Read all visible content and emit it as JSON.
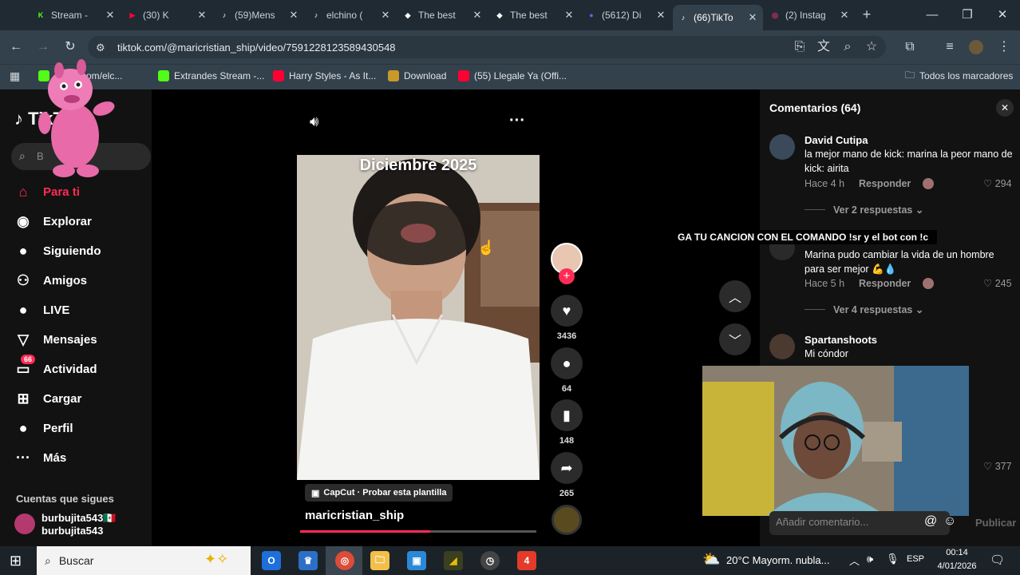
{
  "browser": {
    "tabs": [
      {
        "title": "Stream - ",
        "fav_letter": "K",
        "fav_color": "#53fc18"
      },
      {
        "title": "(30) K",
        "fav_letter": "▶",
        "fav_color": "#ff0033"
      },
      {
        "title": "(59)Mens",
        "fav_letter": "♪",
        "fav_color": "#ffffff"
      },
      {
        "title": "elchino (",
        "fav_letter": "♪",
        "fav_color": "#ffffff"
      },
      {
        "title": "The best",
        "fav_letter": "◆",
        "fav_color": "#ffffff"
      },
      {
        "title": "The best",
        "fav_letter": "◆",
        "fav_color": "#ffffff"
      },
      {
        "title": "(5612) Di",
        "fav_letter": "●",
        "fav_color": "#5865f2"
      },
      {
        "title": "(66)TikTo",
        "fav_letter": "♪",
        "fav_color": "#ffffff"
      },
      {
        "title": "(2) Instag",
        "fav_letter": "◎",
        "fav_color": "#e1306c"
      }
    ],
    "url": "tiktok.com/@maricristian_ship/video/7591228123589430548",
    "bookmarks": [
      {
        "label": "://kick.com/elc...",
        "color": "#53fc18"
      },
      {
        "label": "Extrandes Stream -...",
        "color": "#53fc18"
      },
      {
        "label": "Harry Styles - As It...",
        "color": "#ff0033"
      },
      {
        "label": "Download",
        "color": "#c79a2a"
      },
      {
        "label": "(55) Llegale Ya (Offi...",
        "color": "#ff0033"
      }
    ],
    "all_bookmarks": "Todos los marcadores"
  },
  "sidebar": {
    "logo_text": "TikTok",
    "search_placeholder": "B",
    "nav": [
      {
        "label": "Para ti",
        "icon": "home-icon",
        "active": true
      },
      {
        "label": "Explorar",
        "icon": "compass-icon"
      },
      {
        "label": "Siguiendo",
        "icon": "following-avatar-icon"
      },
      {
        "label": "Amigos",
        "icon": "friends-icon"
      },
      {
        "label": "LIVE",
        "icon": "live-icon"
      },
      {
        "label": "Mensajes",
        "icon": "messages-icon"
      },
      {
        "label": "Actividad",
        "icon": "activity-icon",
        "badge": "66"
      },
      {
        "label": "Cargar",
        "icon": "upload-icon"
      },
      {
        "label": "Perfil",
        "icon": "profile-icon"
      },
      {
        "label": "Más",
        "icon": "more-icon"
      }
    ],
    "following_title": "Cuentas que sigues",
    "following": [
      {
        "name": "burbujita543🇲🇽",
        "handle": "burbujita543"
      }
    ]
  },
  "video": {
    "caption": "Diciembre 2025",
    "capcut_label": "CapCut · Probar esta plantilla",
    "author": "maricristian_ship",
    "progress": 0.55,
    "likes": "3436",
    "comments": "64",
    "saves": "148",
    "shares": "265"
  },
  "overlay_text": "GA TU CANCION CON EL COMANDO !sr y el bot con !c",
  "comments_panel": {
    "title": "Comentarios (64)",
    "comments": [
      {
        "name": "David Cutipa",
        "text": "la mejor mano de kick: marina la peor mano de kick: airita",
        "time": "Hace 4 h",
        "reply": "Responder",
        "likes": "294",
        "replies": "Ver 2 respuestas"
      },
      {
        "name": "",
        "text": "Marina pudo cambiar la vida de un hombre para ser mejor 💪💧",
        "time": "Hace 5 h",
        "reply": "Responder",
        "likes": "245",
        "replies": "Ver 4 respuestas"
      },
      {
        "name": "Spartanshoots",
        "text": "Mi cóndor",
        "likes": "377"
      }
    ],
    "add_placeholder": "Añadir comentario...",
    "publish": "Publicar"
  },
  "taskbar": {
    "search": "Buscar",
    "weather": "20°C  Mayorm. nubla...",
    "lang": "ESP",
    "time": "00:14",
    "date": "4/01/2026"
  }
}
